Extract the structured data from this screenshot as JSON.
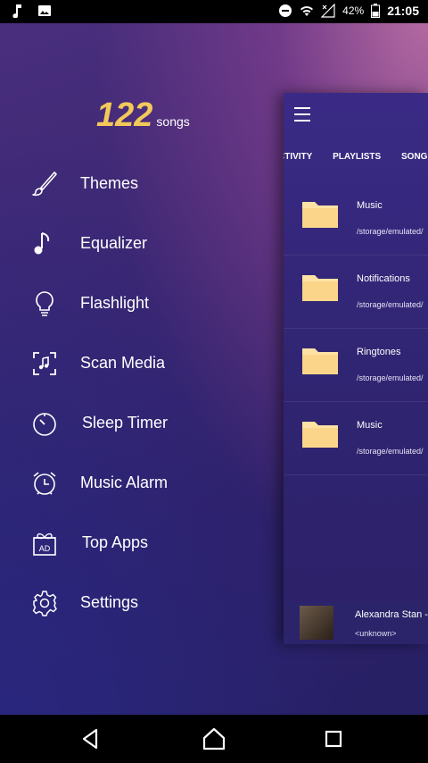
{
  "status_bar": {
    "battery": "42%",
    "time": "21:05",
    "icons": [
      "music-note-icon",
      "image-icon",
      "dnd-icon",
      "wifi-icon",
      "signal-icon",
      "battery-icon"
    ]
  },
  "drawer": {
    "song_count": "122",
    "song_label": "songs",
    "items": [
      {
        "label": "Themes",
        "icon": "brush-icon"
      },
      {
        "label": "Equalizer",
        "icon": "music-note-icon"
      },
      {
        "label": "Flashlight",
        "icon": "lightbulb-icon"
      },
      {
        "label": "Scan Media",
        "icon": "scan-icon"
      },
      {
        "label": "Sleep Timer",
        "icon": "timer-icon"
      },
      {
        "label": "Music Alarm",
        "icon": "alarm-icon"
      },
      {
        "label": "Top Apps",
        "icon": "ad-gift-icon"
      },
      {
        "label": "Settings",
        "icon": "gear-icon"
      }
    ]
  },
  "background_app": {
    "tabs": [
      "CTIVITY",
      "PLAYLISTS",
      "SONG"
    ],
    "folders": [
      {
        "name": "Music",
        "path": "/storage/emulated/"
      },
      {
        "name": "Notifications",
        "path": "/storage/emulated/"
      },
      {
        "name": "Ringtones",
        "path": "/storage/emulated/"
      },
      {
        "name": "Music",
        "path": "/storage/emulated/"
      }
    ],
    "now_playing": {
      "title": "Alexandra Stan - ",
      "artist": "<unknown>"
    }
  },
  "colors": {
    "accent_count": "#f3c95a",
    "folder": "#fde2a4"
  }
}
